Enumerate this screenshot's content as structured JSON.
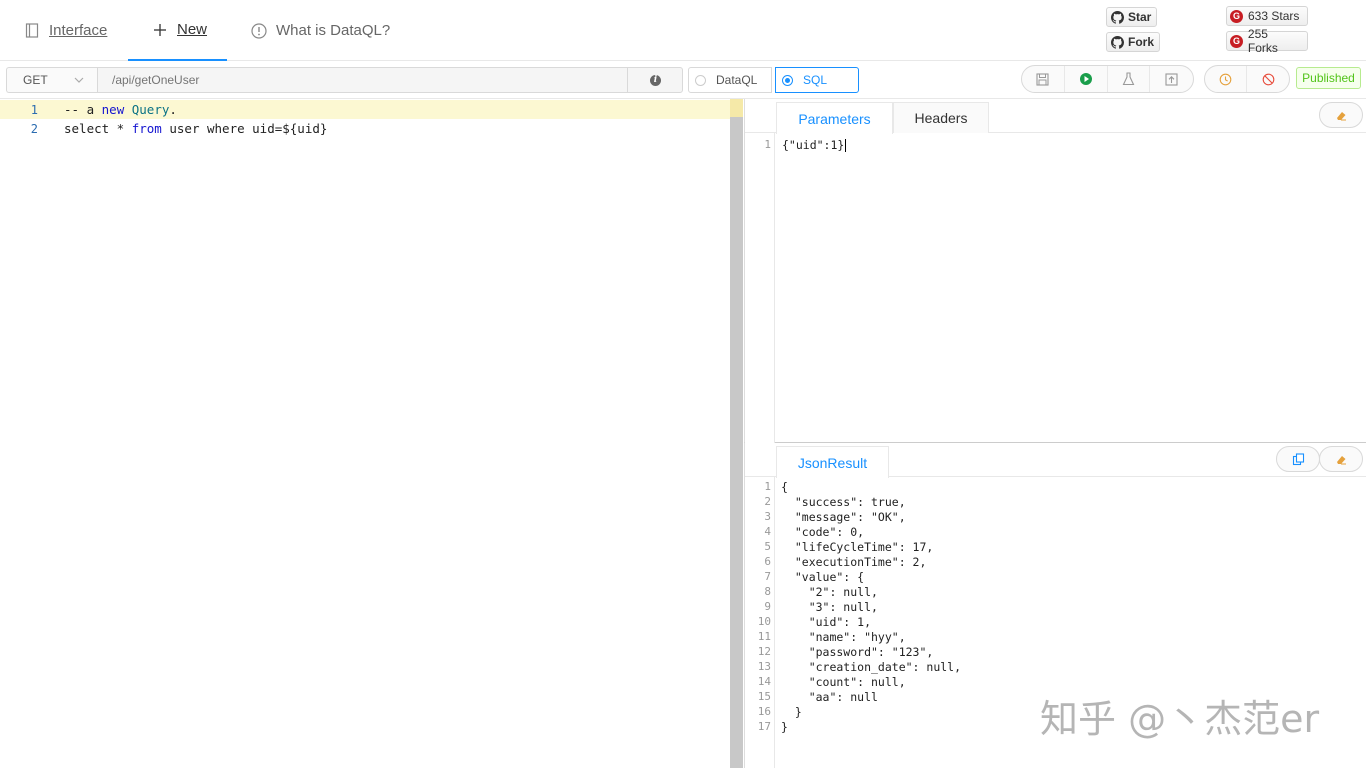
{
  "nav": {
    "tabs": [
      {
        "label": "Interface",
        "icon": "book-icon"
      },
      {
        "label": "New",
        "icon": "plus-icon"
      },
      {
        "label": "What is DataQL?",
        "icon": "info-circle-icon"
      }
    ],
    "github": {
      "star": "Star",
      "fork": "Fork"
    },
    "gitee": {
      "stars": "633 Stars",
      "forks": "255 Forks"
    }
  },
  "toolbar": {
    "method": "GET",
    "path_placeholder": "/api/getOneUser",
    "query_type_options": [
      "DataQL",
      "SQL"
    ],
    "query_type_selected": "SQL",
    "status": "Published",
    "status_color": "#52c41a",
    "accent": "#1890ff"
  },
  "editor": {
    "lines": [
      {
        "num": "1",
        "p1": "-- a ",
        "p2": "new",
        "p3": " ",
        "p4": "Query",
        "p5": "."
      },
      {
        "num": "2",
        "p1": "select * ",
        "p2": "from",
        "p3": " user where uid=${uid}",
        "p4": "",
        "p5": ""
      }
    ]
  },
  "params": {
    "tabs": [
      "Parameters",
      "Headers"
    ],
    "lines": [
      {
        "num": "1",
        "text": "{\"uid\":1}"
      }
    ]
  },
  "result": {
    "tab": "JsonResult",
    "lines": [
      {
        "num": "1",
        "text": "{"
      },
      {
        "num": "2",
        "text": "  \"success\": true,"
      },
      {
        "num": "3",
        "text": "  \"message\": \"OK\","
      },
      {
        "num": "4",
        "text": "  \"code\": 0,"
      },
      {
        "num": "5",
        "text": "  \"lifeCycleTime\": 17,"
      },
      {
        "num": "6",
        "text": "  \"executionTime\": 2,"
      },
      {
        "num": "7",
        "text": "  \"value\": {"
      },
      {
        "num": "8",
        "text": "    \"2\": null,"
      },
      {
        "num": "9",
        "text": "    \"3\": null,"
      },
      {
        "num": "10",
        "text": "    \"uid\": 1,"
      },
      {
        "num": "11",
        "text": "    \"name\": \"hyy\","
      },
      {
        "num": "12",
        "text": "    \"password\": \"123\","
      },
      {
        "num": "13",
        "text": "    \"creation_date\": null,"
      },
      {
        "num": "14",
        "text": "    \"count\": null,"
      },
      {
        "num": "15",
        "text": "    \"aa\": null"
      },
      {
        "num": "16",
        "text": "  }"
      },
      {
        "num": "17",
        "text": "}"
      }
    ]
  },
  "watermark": "知乎 @丶杰范er"
}
